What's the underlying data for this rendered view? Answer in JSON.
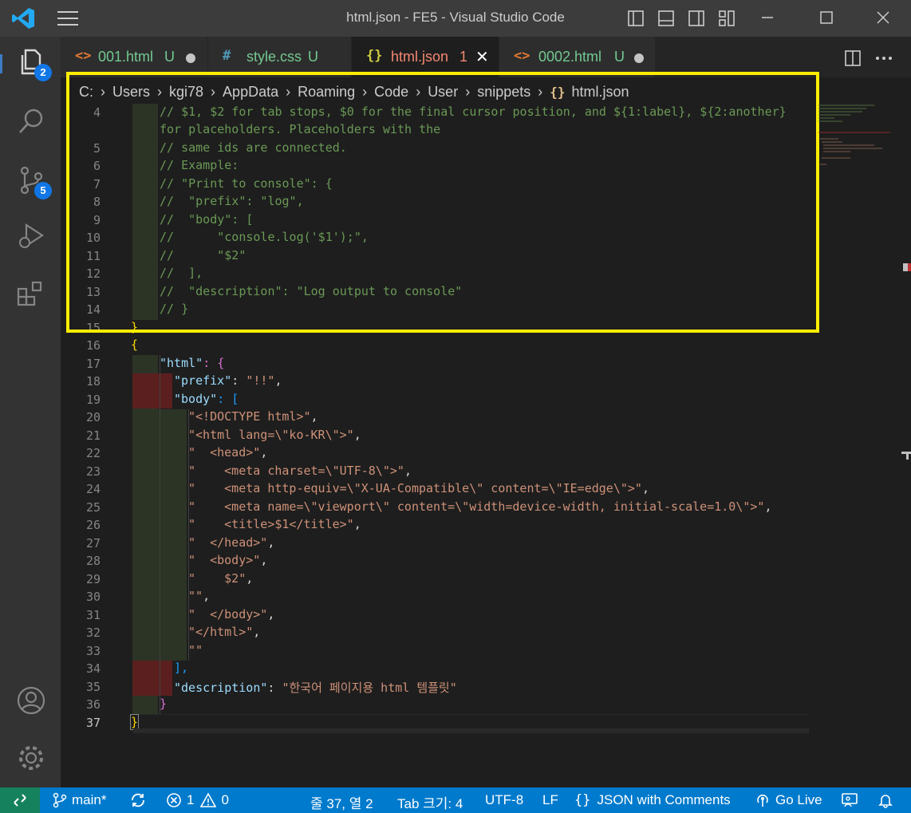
{
  "window": {
    "title": "html.json - FE5 - Visual Studio Code"
  },
  "activity": {
    "explorer_badge": "2",
    "scm_badge": "5"
  },
  "tabs": [
    {
      "icon": "<>",
      "label": "001.html",
      "status": "U"
    },
    {
      "icon": "#",
      "label": "style.css",
      "status": "U"
    },
    {
      "icon": "{}",
      "label": "html.json",
      "status": "1"
    },
    {
      "icon": "<>",
      "label": "0002.html",
      "status": "U"
    }
  ],
  "breadcrumb": [
    "C:",
    "Users",
    "kgi78",
    "AppData",
    "Roaming",
    "Code",
    "User",
    "snippets",
    "html.json"
  ],
  "editor": {
    "lines": [
      {
        "n": "4",
        "text": "// $1, $2 for tab stops, $0 for the final cursor position, and ${1:label}, ${2:another}"
      },
      {
        "n": "",
        "text": "for placeholders. Placeholders with the"
      },
      {
        "n": "5",
        "text": "// same ids are connected."
      },
      {
        "n": "6",
        "text": "// Example:"
      },
      {
        "n": "7",
        "text": "// \"Print to console\": {"
      },
      {
        "n": "8",
        "text": "//  \"prefix\": \"log\","
      },
      {
        "n": "9",
        "text": "//  \"body\": ["
      },
      {
        "n": "10",
        "text": "//      \"console.log('$1');\","
      },
      {
        "n": "11",
        "text": "//      \"$2\""
      },
      {
        "n": "12",
        "text": "//  ],"
      },
      {
        "n": "13",
        "text": "//  \"description\": \"Log output to console\""
      },
      {
        "n": "14",
        "text": "// }"
      },
      {
        "n": "15",
        "text": "}"
      },
      {
        "n": "16",
        "text": "{"
      },
      {
        "n": "17",
        "key": "\"html\"",
        "rest": ": {"
      },
      {
        "n": "18",
        "key": "\"prefix\"",
        "rest": ": ",
        "str": "\"!!\"",
        "tail": ","
      },
      {
        "n": "19",
        "key": "\"body\"",
        "rest": ": ["
      },
      {
        "n": "20",
        "str": "\"<!DOCTYPE html>\"",
        "tail": ","
      },
      {
        "n": "21",
        "str": "\"<html lang=\\\"ko-KR\\\">\"",
        "tail": ","
      },
      {
        "n": "22",
        "str": "\"  <head>\"",
        "tail": ","
      },
      {
        "n": "23",
        "str": "\"    <meta charset=\\\"UTF-8\\\">\"",
        "tail": ","
      },
      {
        "n": "24",
        "str": "\"    <meta http-equiv=\\\"X-UA-Compatible\\\" content=\\\"IE=edge\\\">\"",
        "tail": ","
      },
      {
        "n": "25",
        "str": "\"    <meta name=\\\"viewport\\\" content=\\\"width=device-width, initial-scale=1.0\\\">\"",
        "tail": ","
      },
      {
        "n": "26",
        "str": "\"    <title>$1</title>\"",
        "tail": ","
      },
      {
        "n": "27",
        "str": "\"  </head>\"",
        "tail": ","
      },
      {
        "n": "28",
        "str": "\"  <body>\"",
        "tail": ","
      },
      {
        "n": "29",
        "str": "\"    $2\"",
        "tail": ","
      },
      {
        "n": "30",
        "str": "\"\"",
        "tail": ","
      },
      {
        "n": "31",
        "str": "\"  </body>\"",
        "tail": ","
      },
      {
        "n": "32",
        "str": "\"</html>\"",
        "tail": ","
      },
      {
        "n": "33",
        "str": "\"\""
      },
      {
        "n": "34",
        "text": "],"
      },
      {
        "n": "35",
        "key": "\"description\"",
        "rest": ": ",
        "str": "\"한국어 페이지용 html 템플릿\""
      },
      {
        "n": "36",
        "text": "}"
      },
      {
        "n": "37",
        "text": "}"
      }
    ]
  },
  "statusbar": {
    "branch": "main*",
    "errors": "1",
    "warnings": "0",
    "position": "줄 37, 열 2",
    "tab_size": "Tab 크기: 4",
    "encoding": "UTF-8",
    "eol": "LF",
    "language": "JSON with Comments",
    "go_live": "Go Live"
  },
  "colors": {
    "accent": "#007acc",
    "highlight_box": "#ffee00",
    "remote": "#16825d"
  }
}
